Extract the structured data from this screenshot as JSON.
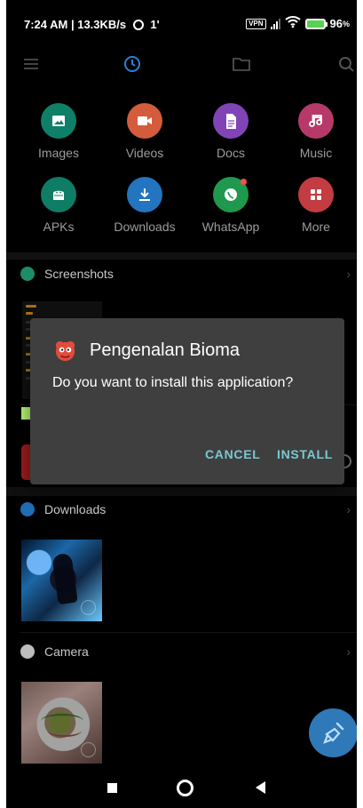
{
  "status_bar": {
    "time_speed": "7:24 AM | 13.3KB/s",
    "extra": "1'",
    "vpn": "VPN",
    "battery": "96"
  },
  "toolbar": {
    "icons": [
      "menu-icon",
      "clock-icon",
      "folder-icon",
      "search-icon"
    ],
    "accent": "#2e7fd1"
  },
  "categories": [
    {
      "label": "Images",
      "icon": "image-icon",
      "color": "#0f7f68"
    },
    {
      "label": "Videos",
      "icon": "video-icon",
      "color": "#d45c3c"
    },
    {
      "label": "Docs",
      "icon": "document-icon",
      "color": "#8144b6"
    },
    {
      "label": "Music",
      "icon": "music-icon",
      "color": "#b73969"
    },
    {
      "label": "APKs",
      "icon": "android-icon",
      "color": "#0f7d65"
    },
    {
      "label": "Downloads",
      "icon": "download-icon",
      "color": "#2375bf"
    },
    {
      "label": "WhatsApp",
      "icon": "whatsapp-icon",
      "color": "#20984d"
    },
    {
      "label": "More",
      "icon": "grid-icon",
      "color": "#c23c42"
    }
  ],
  "sections": {
    "screenshots": "Screenshots",
    "downloads": "Downloads",
    "camera": "Camera"
  },
  "dialog": {
    "title": "Pengenalan Bioma",
    "message": "Do you want to install this application?",
    "cancel_label": "CANCEL",
    "install_label": "INSTALL",
    "button_color": "#79c8d2",
    "app_icon": "red-creature-icon"
  },
  "fab": {
    "icon": "broom-icon",
    "color": "#2f79b8"
  },
  "navigation": {
    "icons": [
      "recent-apps-icon",
      "home-icon",
      "back-icon"
    ]
  }
}
